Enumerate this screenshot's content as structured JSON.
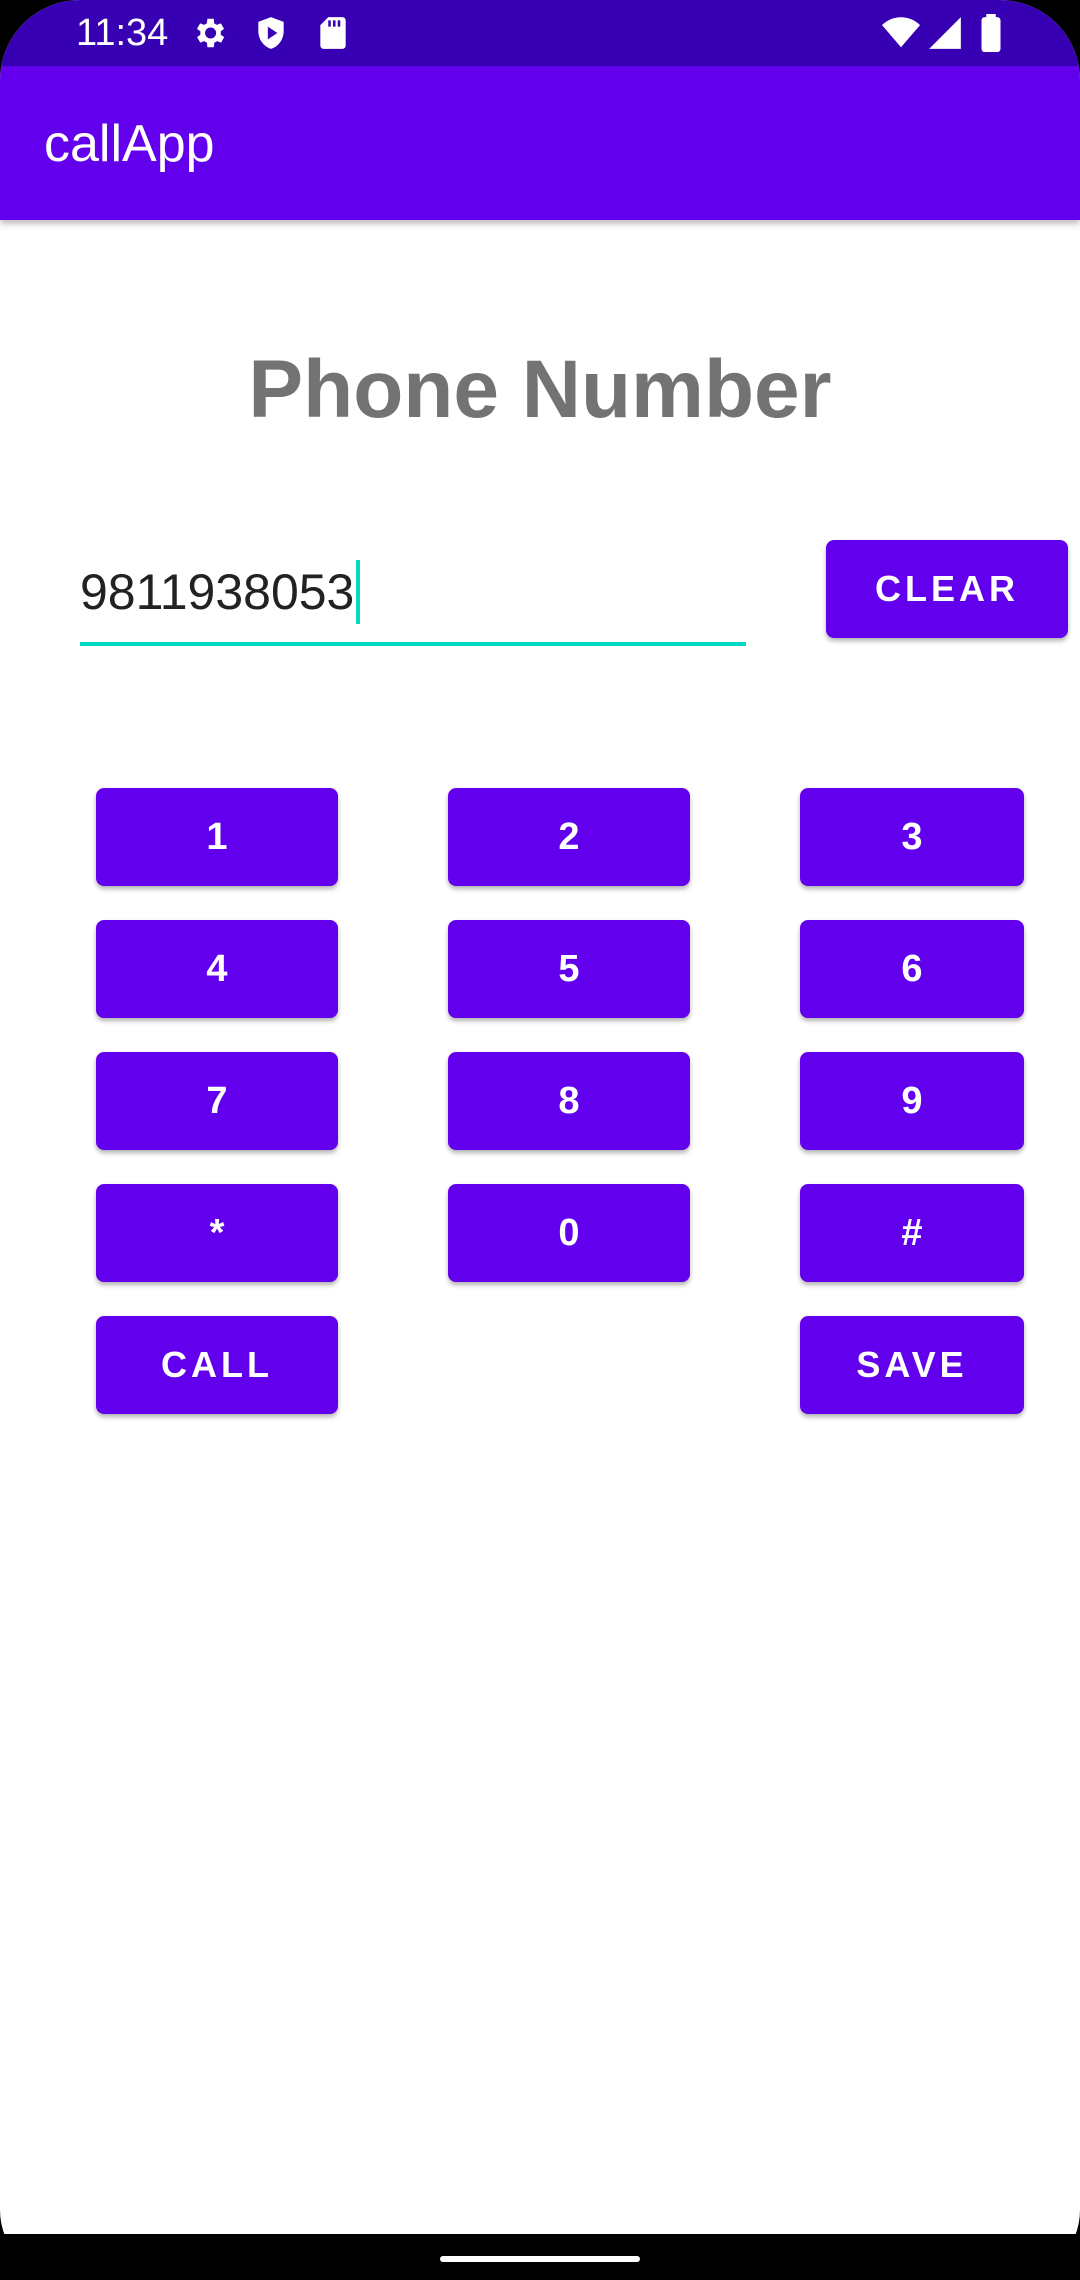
{
  "status_bar": {
    "time": "11:34",
    "left_icons": [
      "gear-icon",
      "shield-play-icon",
      "sd-card-icon"
    ],
    "right_icons": [
      "wifi-icon",
      "signal-icon",
      "battery-icon"
    ]
  },
  "app_bar": {
    "title": "callApp"
  },
  "main": {
    "heading": "Phone Number",
    "phone_input": {
      "value": "9811938053"
    },
    "clear_label": "CLEAR"
  },
  "keypad": {
    "keys": [
      "1",
      "2",
      "3",
      "4",
      "5",
      "6",
      "7",
      "8",
      "9",
      "*",
      "0",
      "#"
    ],
    "call_label": "CALL",
    "save_label": "SAVE"
  },
  "colors": {
    "status_bar": "#3700b3",
    "primary": "#6200ee",
    "accent": "#03dac5",
    "heading_text": "#737373"
  }
}
